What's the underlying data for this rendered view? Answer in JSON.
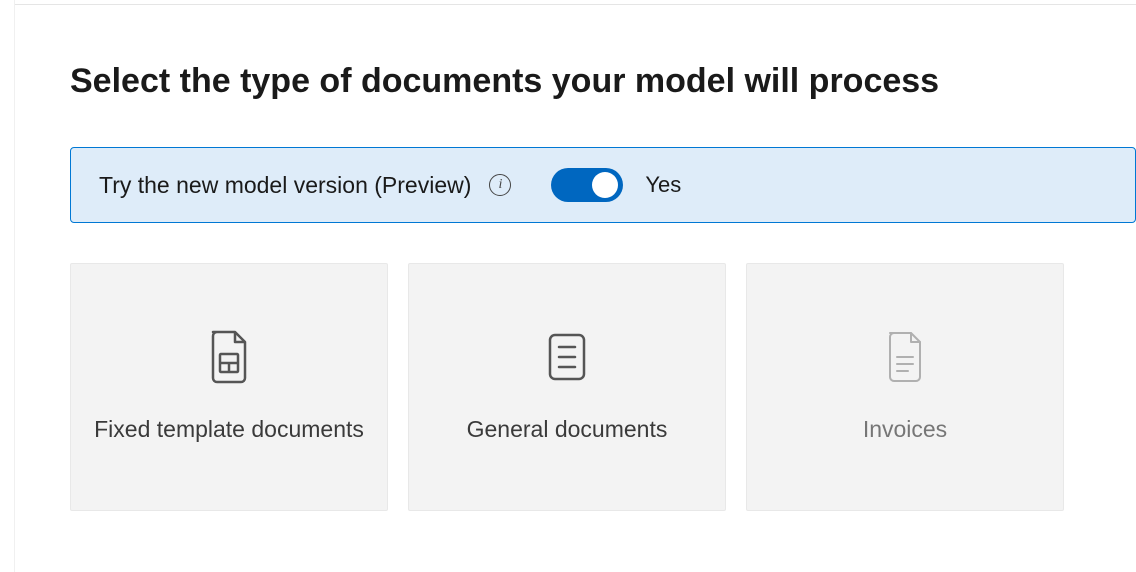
{
  "page": {
    "title": "Select the type of documents your model will process"
  },
  "preview": {
    "label": "Try the new model version (Preview)",
    "toggle_state": "Yes"
  },
  "cards": [
    {
      "label": "Fixed template documents",
      "icon": "document-table",
      "disabled": false
    },
    {
      "label": "General documents",
      "icon": "document-lines",
      "disabled": false
    },
    {
      "label": "Invoices",
      "icon": "document-invoice",
      "disabled": true
    }
  ]
}
